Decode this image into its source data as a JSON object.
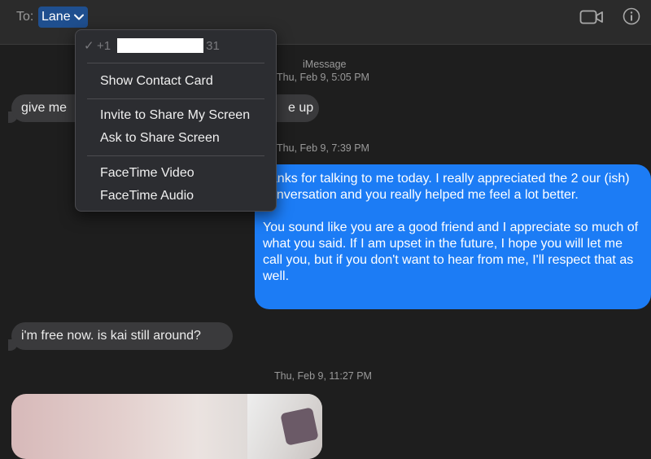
{
  "header": {
    "to_label": "To:",
    "recipient": "Lane",
    "icons": [
      "chevron-down-icon",
      "video-call-icon",
      "info-icon"
    ]
  },
  "conversation": {
    "service": "iMessage",
    "stamp_1": "Thu, Feb 9, 5:05 PM",
    "msg_1_left": "give me",
    "msg_1_right": "e up",
    "stamp_2": "Thu, Feb 9, 7:39 PM",
    "msg_2_para_1": "hanks for talking to me today. I really appreciated the 2 our (ish) conversation and you really helped me feel a lot better.",
    "msg_2_para_2": "You sound like you are a good friend and I appreciate so much of what you said. If I am upset in the future, I hope you will let me call you, but if you don't want to hear from me, I'll respect that as well.",
    "msg_3": "i'm free now. is kai still around?",
    "stamp_3": "Thu, Feb 9, 11:27 PM"
  },
  "menu": {
    "phone_prefix": "+1",
    "phone_suffix": "31",
    "items": [
      "Show Contact Card",
      "Invite to Share My Screen",
      "Ask to Share Screen",
      "FaceTime Video",
      "FaceTime Audio"
    ]
  },
  "colors": {
    "sent_bubble": "#1c7cf5",
    "received_bubble": "#3a3a3c",
    "recipient_highlight": "#1f4f8f"
  }
}
